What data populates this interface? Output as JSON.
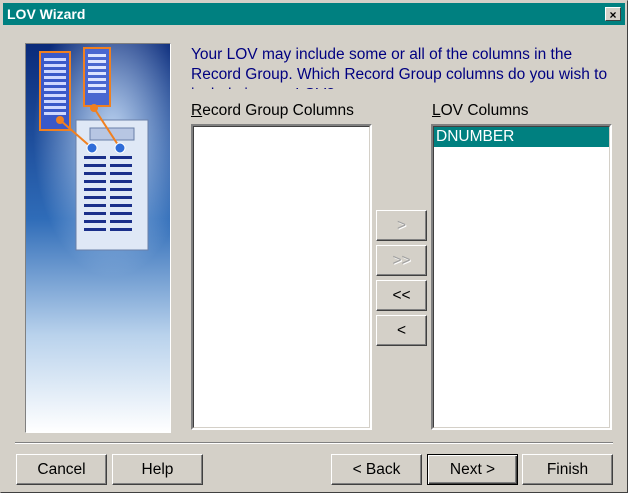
{
  "window": {
    "title": "LOV Wizard",
    "close_label": "×"
  },
  "instruction": "Your LOV may include some or all of the columns in the Record Group. Which Record Group columns do you wish to include in your LOV?",
  "record_group": {
    "label_mnemonic": "R",
    "label_rest": "ecord Group Columns",
    "items": []
  },
  "lov_columns": {
    "label_mnemonic": "L",
    "label_rest": "OV Columns",
    "items": [
      "DNUMBER"
    ],
    "selected_index": 0
  },
  "transfer_buttons": {
    "add_one": "&gt;",
    "add_all": "&gt;&gt;",
    "remove_all": "&lt;&lt;",
    "remove_one": "&lt;"
  },
  "footer": {
    "cancel": "Cancel",
    "help": "Help",
    "back": "&lt; Back",
    "next": "Next &gt;",
    "finish": "Finish"
  },
  "colors": {
    "title_bar": "#008080",
    "selection": "#008080",
    "instruction_text": "#000080",
    "dialog_bg": "#d4d0c8"
  }
}
